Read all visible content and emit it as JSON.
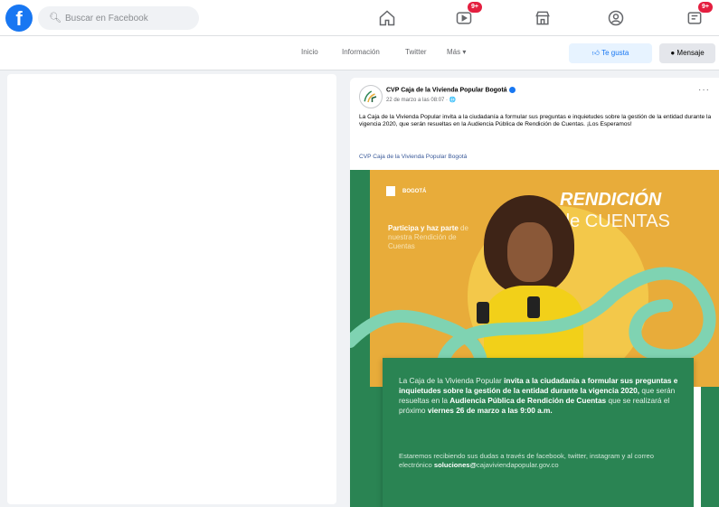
{
  "search": {
    "placeholder": "Buscar en Facebook"
  },
  "nav": {
    "watch_badge": "9+",
    "notifications_badge": "9+"
  },
  "tabs": [
    "Inicio",
    "Información",
    "Twitter",
    "Más ▾"
  ],
  "actions": {
    "like": "Te gusta",
    "message": "Mensaje"
  },
  "post": {
    "author": "CVP Caja de la Vivienda Popular Bogotá",
    "date": "22 de marzo a las 08:07 · 🌐",
    "text": "La Caja de la Vivienda Popular invita a la ciudadanía a formular sus preguntas e inquietudes sobre la gestión de la entidad durante la vigencia 2020, que serán resueltas en la Audiencia Pública de Rendición de Cuentas. ¡Los Esperamos!",
    "link": "CVP Caja de la Vivienda Popular Bogotá",
    "image": {
      "title1": "RENDICIÓN",
      "title2": "de CUENTAS",
      "participa_bold": "Participa y haz parte",
      "participa_rest": "de nuestra Rendición de Cuentas",
      "logos": "BOGOTÁ",
      "body_lead": "La Caja de la Vivienda Popular ",
      "body_bold1": "invita a la ciudadanía a formular sus preguntas e inquietudes sobre la gestión de la entidad durante la vigencia 2020,",
      "body_mid": " que serán resueltas en la ",
      "body_bold2": "Audiencia Pública de Rendición de Cuentas",
      "body_mid2": " que se realizará el próximo ",
      "body_bold3": "viernes 26 de marzo a las 9:00 a.m.",
      "contact_lead": "Estaremos recibiendo sus dudas a través de facebook, twitter, instagram y al correo electrónico ",
      "contact_email_bold": "soluciones@",
      "contact_email_rest": "cajaviviendapopular.gov.co"
    }
  },
  "colors": {
    "brand": "#1877f2",
    "green": "#2a8453",
    "yellow": "#e8ac3a",
    "mint": "#7fd3b2"
  }
}
